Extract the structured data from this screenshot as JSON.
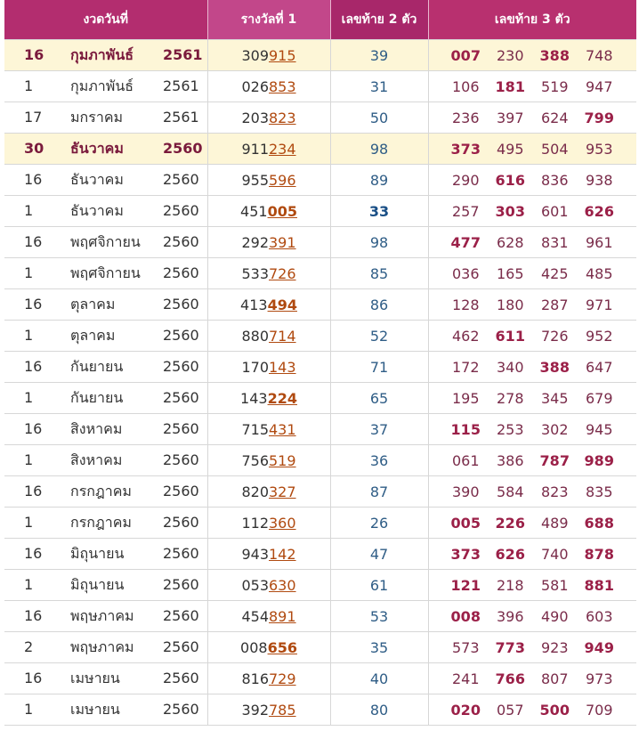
{
  "header": {
    "col_date": "งวดวันที่",
    "col_first": "รางวัลที่ 1",
    "col_two": "เลขท้าย 2 ตัว",
    "col_three": "เลขท้าย 3 ตัว"
  },
  "rows": [
    {
      "day": "16",
      "month": "กุมภาพันธ์",
      "year": "2561",
      "highlight": true,
      "prize_prefix": "309",
      "prize_suffix": "915",
      "suffix_bold": false,
      "two": "39",
      "two_bold": false,
      "three": [
        {
          "v": "007",
          "b": true
        },
        {
          "v": "230",
          "b": false
        },
        {
          "v": "388",
          "b": true
        },
        {
          "v": "748",
          "b": false
        }
      ]
    },
    {
      "day": "1",
      "month": "กุมภาพันธ์",
      "year": "2561",
      "highlight": false,
      "prize_prefix": "026",
      "prize_suffix": "853",
      "suffix_bold": false,
      "two": "31",
      "two_bold": false,
      "three": [
        {
          "v": "106",
          "b": false
        },
        {
          "v": "181",
          "b": true
        },
        {
          "v": "519",
          "b": false
        },
        {
          "v": "947",
          "b": false
        }
      ]
    },
    {
      "day": "17",
      "month": "มกราคม",
      "year": "2561",
      "highlight": false,
      "prize_prefix": "203",
      "prize_suffix": "823",
      "suffix_bold": false,
      "two": "50",
      "two_bold": false,
      "three": [
        {
          "v": "236",
          "b": false
        },
        {
          "v": "397",
          "b": false
        },
        {
          "v": "624",
          "b": false
        },
        {
          "v": "799",
          "b": true
        }
      ]
    },
    {
      "day": "30",
      "month": "ธันวาคม",
      "year": "2560",
      "highlight": true,
      "prize_prefix": "911",
      "prize_suffix": "234",
      "suffix_bold": false,
      "two": "98",
      "two_bold": false,
      "three": [
        {
          "v": "373",
          "b": true
        },
        {
          "v": "495",
          "b": false
        },
        {
          "v": "504",
          "b": false
        },
        {
          "v": "953",
          "b": false
        }
      ]
    },
    {
      "day": "16",
      "month": "ธันวาคม",
      "year": "2560",
      "highlight": false,
      "prize_prefix": "955",
      "prize_suffix": "596",
      "suffix_bold": false,
      "two": "89",
      "two_bold": false,
      "three": [
        {
          "v": "290",
          "b": false
        },
        {
          "v": "616",
          "b": true
        },
        {
          "v": "836",
          "b": false
        },
        {
          "v": "938",
          "b": false
        }
      ]
    },
    {
      "day": "1",
      "month": "ธันวาคม",
      "year": "2560",
      "highlight": false,
      "prize_prefix": "451",
      "prize_suffix": "005",
      "suffix_bold": true,
      "two": "33",
      "two_bold": true,
      "three": [
        {
          "v": "257",
          "b": false
        },
        {
          "v": "303",
          "b": true
        },
        {
          "v": "601",
          "b": false
        },
        {
          "v": "626",
          "b": true
        }
      ]
    },
    {
      "day": "16",
      "month": "พฤศจิกายน",
      "year": "2560",
      "highlight": false,
      "prize_prefix": "292",
      "prize_suffix": "391",
      "suffix_bold": false,
      "two": "98",
      "two_bold": false,
      "three": [
        {
          "v": "477",
          "b": true
        },
        {
          "v": "628",
          "b": false
        },
        {
          "v": "831",
          "b": false
        },
        {
          "v": "961",
          "b": false
        }
      ]
    },
    {
      "day": "1",
      "month": "พฤศจิกายน",
      "year": "2560",
      "highlight": false,
      "prize_prefix": "533",
      "prize_suffix": "726",
      "suffix_bold": false,
      "two": "85",
      "two_bold": false,
      "three": [
        {
          "v": "036",
          "b": false
        },
        {
          "v": "165",
          "b": false
        },
        {
          "v": "425",
          "b": false
        },
        {
          "v": "485",
          "b": false
        }
      ]
    },
    {
      "day": "16",
      "month": "ตุลาคม",
      "year": "2560",
      "highlight": false,
      "prize_prefix": "413",
      "prize_suffix": "494",
      "suffix_bold": true,
      "two": "86",
      "two_bold": false,
      "three": [
        {
          "v": "128",
          "b": false
        },
        {
          "v": "180",
          "b": false
        },
        {
          "v": "287",
          "b": false
        },
        {
          "v": "971",
          "b": false
        }
      ]
    },
    {
      "day": "1",
      "month": "ตุลาคม",
      "year": "2560",
      "highlight": false,
      "prize_prefix": "880",
      "prize_suffix": "714",
      "suffix_bold": false,
      "two": "52",
      "two_bold": false,
      "three": [
        {
          "v": "462",
          "b": false
        },
        {
          "v": "611",
          "b": true
        },
        {
          "v": "726",
          "b": false
        },
        {
          "v": "952",
          "b": false
        }
      ]
    },
    {
      "day": "16",
      "month": "กันยายน",
      "year": "2560",
      "highlight": false,
      "prize_prefix": "170",
      "prize_suffix": "143",
      "suffix_bold": false,
      "two": "71",
      "two_bold": false,
      "three": [
        {
          "v": "172",
          "b": false
        },
        {
          "v": "340",
          "b": false
        },
        {
          "v": "388",
          "b": true
        },
        {
          "v": "647",
          "b": false
        }
      ]
    },
    {
      "day": "1",
      "month": "กันยายน",
      "year": "2560",
      "highlight": false,
      "prize_prefix": "143",
      "prize_suffix": "224",
      "suffix_bold": true,
      "two": "65",
      "two_bold": false,
      "three": [
        {
          "v": "195",
          "b": false
        },
        {
          "v": "278",
          "b": false
        },
        {
          "v": "345",
          "b": false
        },
        {
          "v": "679",
          "b": false
        }
      ]
    },
    {
      "day": "16",
      "month": "สิงหาคม",
      "year": "2560",
      "highlight": false,
      "prize_prefix": "715",
      "prize_suffix": "431",
      "suffix_bold": false,
      "two": "37",
      "two_bold": false,
      "three": [
        {
          "v": "115",
          "b": true
        },
        {
          "v": "253",
          "b": false
        },
        {
          "v": "302",
          "b": false
        },
        {
          "v": "945",
          "b": false
        }
      ]
    },
    {
      "day": "1",
      "month": "สิงหาคม",
      "year": "2560",
      "highlight": false,
      "prize_prefix": "756",
      "prize_suffix": "519",
      "suffix_bold": false,
      "two": "36",
      "two_bold": false,
      "three": [
        {
          "v": "061",
          "b": false
        },
        {
          "v": "386",
          "b": false
        },
        {
          "v": "787",
          "b": true
        },
        {
          "v": "989",
          "b": true
        }
      ]
    },
    {
      "day": "16",
      "month": "กรกฎาคม",
      "year": "2560",
      "highlight": false,
      "prize_prefix": "820",
      "prize_suffix": "327",
      "suffix_bold": false,
      "two": "87",
      "two_bold": false,
      "three": [
        {
          "v": "390",
          "b": false
        },
        {
          "v": "584",
          "b": false
        },
        {
          "v": "823",
          "b": false
        },
        {
          "v": "835",
          "b": false
        }
      ]
    },
    {
      "day": "1",
      "month": "กรกฎาคม",
      "year": "2560",
      "highlight": false,
      "prize_prefix": "112",
      "prize_suffix": "360",
      "suffix_bold": false,
      "two": "26",
      "two_bold": false,
      "three": [
        {
          "v": "005",
          "b": true
        },
        {
          "v": "226",
          "b": true
        },
        {
          "v": "489",
          "b": false
        },
        {
          "v": "688",
          "b": true
        }
      ]
    },
    {
      "day": "16",
      "month": "มิถุนายน",
      "year": "2560",
      "highlight": false,
      "prize_prefix": "943",
      "prize_suffix": "142",
      "suffix_bold": false,
      "two": "47",
      "two_bold": false,
      "three": [
        {
          "v": "373",
          "b": true
        },
        {
          "v": "626",
          "b": true
        },
        {
          "v": "740",
          "b": false
        },
        {
          "v": "878",
          "b": true
        }
      ]
    },
    {
      "day": "1",
      "month": "มิถุนายน",
      "year": "2560",
      "highlight": false,
      "prize_prefix": "053",
      "prize_suffix": "630",
      "suffix_bold": false,
      "two": "61",
      "two_bold": false,
      "three": [
        {
          "v": "121",
          "b": true
        },
        {
          "v": "218",
          "b": false
        },
        {
          "v": "581",
          "b": false
        },
        {
          "v": "881",
          "b": true
        }
      ]
    },
    {
      "day": "16",
      "month": "พฤษภาคม",
      "year": "2560",
      "highlight": false,
      "prize_prefix": "454",
      "prize_suffix": "891",
      "suffix_bold": false,
      "two": "53",
      "two_bold": false,
      "three": [
        {
          "v": "008",
          "b": true
        },
        {
          "v": "396",
          "b": false
        },
        {
          "v": "490",
          "b": false
        },
        {
          "v": "603",
          "b": false
        }
      ]
    },
    {
      "day": "2",
      "month": "พฤษภาคม",
      "year": "2560",
      "highlight": false,
      "prize_prefix": "008",
      "prize_suffix": "656",
      "suffix_bold": true,
      "two": "35",
      "two_bold": false,
      "three": [
        {
          "v": "573",
          "b": false
        },
        {
          "v": "773",
          "b": true
        },
        {
          "v": "923",
          "b": false
        },
        {
          "v": "949",
          "b": true
        }
      ]
    },
    {
      "day": "16",
      "month": "เมษายน",
      "year": "2560",
      "highlight": false,
      "prize_prefix": "816",
      "prize_suffix": "729",
      "suffix_bold": false,
      "two": "40",
      "two_bold": false,
      "three": [
        {
          "v": "241",
          "b": false
        },
        {
          "v": "766",
          "b": true
        },
        {
          "v": "807",
          "b": false
        },
        {
          "v": "973",
          "b": false
        }
      ]
    },
    {
      "day": "1",
      "month": "เมษายน",
      "year": "2560",
      "highlight": false,
      "prize_prefix": "392",
      "prize_suffix": "785",
      "suffix_bold": false,
      "two": "80",
      "two_bold": false,
      "three": [
        {
          "v": "020",
          "b": true
        },
        {
          "v": "057",
          "b": false
        },
        {
          "v": "500",
          "b": true
        },
        {
          "v": "709",
          "b": false
        }
      ]
    }
  ]
}
